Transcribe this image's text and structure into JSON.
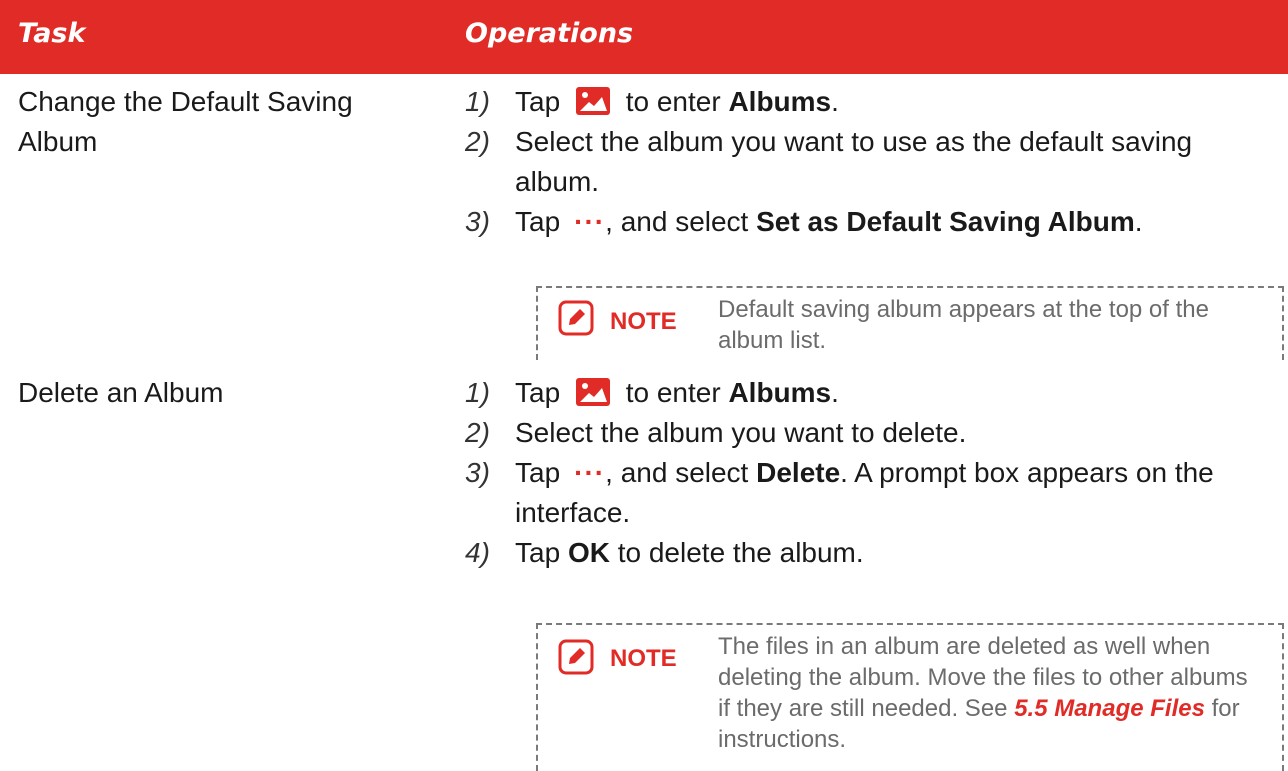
{
  "header": {
    "task": "Task",
    "operations": "Operations"
  },
  "rows": [
    {
      "task": "Change the Default Saving Album",
      "steps": [
        {
          "num": "1)",
          "a": "Tap",
          "b": "to enter",
          "bold": "Albums",
          "end": "."
        },
        {
          "num": "2)",
          "text": "Select the album you want to use as the default saving album."
        },
        {
          "num": "3)",
          "a": "Tap",
          "b": ", and select",
          "bold": "Set as Default Saving Album",
          "end": "."
        }
      ],
      "note": {
        "label": "NOTE",
        "text": "Default saving album appears at the top of the album list."
      }
    },
    {
      "task": "Delete an Album",
      "steps": [
        {
          "num": "1)",
          "a": "Tap",
          "b": "to enter",
          "bold": "Albums",
          "end": "."
        },
        {
          "num": "2)",
          "text": "Select the album you want to delete."
        },
        {
          "num": "3)",
          "a": "Tap",
          "b": ", and select",
          "bold": "Delete",
          "end": ". A prompt box appears on the interface."
        },
        {
          "num": "4)",
          "a": "Tap",
          "bold": "OK",
          "end": "to delete the album."
        }
      ],
      "note": {
        "label": "NOTE",
        "text_a": "The files in an album are deleted as well when deleting the album. Move the files to other albums if they are still needed. See",
        "link": "5.5 Manage Files",
        "text_b": "for instructions."
      }
    }
  ],
  "icons": {
    "album": "album-image-icon",
    "more": "more-dots-icon",
    "note": "edit-note-icon"
  },
  "colors": {
    "accent": "#e02b26",
    "text": "#1a1a1a",
    "note_text": "#6b6b6b"
  }
}
